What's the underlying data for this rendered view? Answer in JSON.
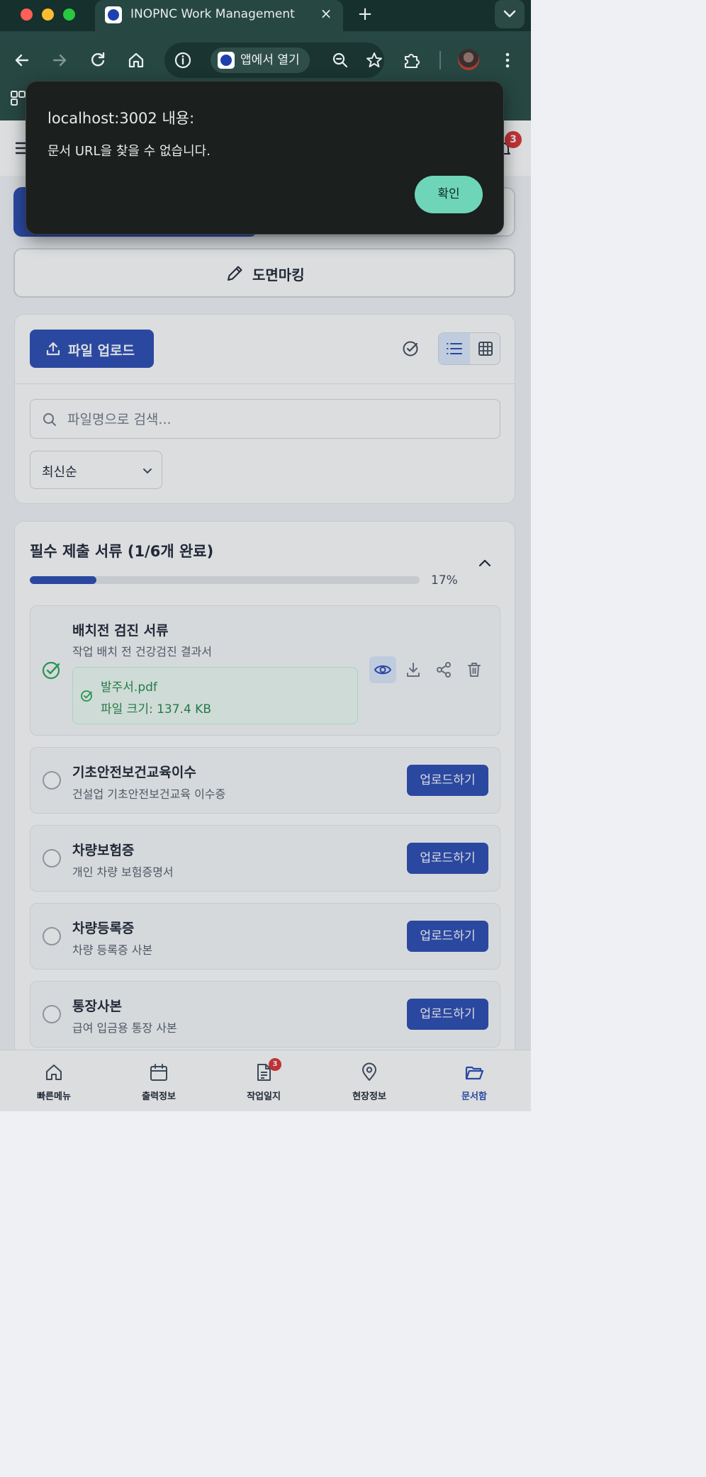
{
  "browser": {
    "tab_title": "INOPNC Work Management",
    "tab_close": "×",
    "new_tab": "+",
    "open_in_app": "앱에서 열기"
  },
  "header": {
    "notification_count": "3"
  },
  "drawing_marking": {
    "label": "도면마킹"
  },
  "toolbar": {
    "upload_label": "파일 업로드"
  },
  "search": {
    "placeholder": "파일명으로 검색..."
  },
  "sort": {
    "selected": "최신순"
  },
  "required_docs": {
    "title": "필수 제출 서류 (1/6개 완료)",
    "progress_percent_label": "17%",
    "progress_value": 0.17,
    "items": [
      {
        "title": "배치전 검진 서류",
        "description": "작업 배치 전 건강검진 결과서",
        "file_name": "발주서.pdf",
        "file_size": "파일 크기: 137.4 KB"
      },
      {
        "title": "기초안전보건교육이수",
        "description": "건설업 기초안전보건교육 이수증",
        "action": "업로드하기"
      },
      {
        "title": "차량보험증",
        "description": "개인 차량 보험증명서",
        "action": "업로드하기"
      },
      {
        "title": "차량등록증",
        "description": "차량 등록증 사본",
        "action": "업로드하기"
      },
      {
        "title": "통장사본",
        "description": "급여 입금용 통장 사본",
        "action": "업로드하기"
      }
    ]
  },
  "bottom_nav": {
    "items": [
      {
        "label": "빠른메뉴"
      },
      {
        "label": "출력정보"
      },
      {
        "label": "작업일지",
        "badge": "3"
      },
      {
        "label": "현장정보"
      },
      {
        "label": "문서함"
      }
    ]
  },
  "dialog": {
    "title": "localhost:3002 내용:",
    "message": "문서 URL을 찾을 수 없습니다.",
    "ok_label": "확인"
  },
  "colors": {
    "primary": "#1e40af",
    "success": "#15803d",
    "badge": "#dc2626",
    "dialog_button": "#6fd5b8"
  }
}
